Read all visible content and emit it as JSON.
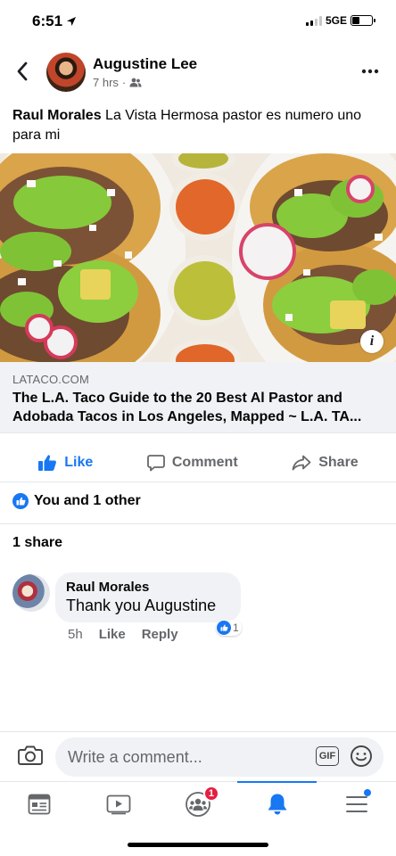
{
  "status_bar": {
    "time": "6:51",
    "network": "5GE",
    "battery_level": 0.4
  },
  "post": {
    "author": "Augustine Lee",
    "time_ago": "7 hrs",
    "audience_icon": "friends-icon",
    "text_author": "Raul Morales",
    "text_body": "La Vista Hermosa pastor es numero uno para mi"
  },
  "link": {
    "domain": "LATACO.COM",
    "title": "The L.A. Taco Guide to the 20 Best Al Pastor and Adobada Tacos in Los Angeles, Mapped ~ L.A. TA..."
  },
  "actions": {
    "like": "Like",
    "comment": "Comment",
    "share": "Share"
  },
  "reactions": {
    "summary": "You and 1 other"
  },
  "shares": {
    "label": "1 share"
  },
  "comment": {
    "author": "Raul Morales",
    "text": "Thank you Augustine",
    "time": "5h",
    "like_label": "Like",
    "reply_label": "Reply",
    "reaction_count": "1"
  },
  "composer": {
    "placeholder": "Write a comment...",
    "gif_label": "GIF"
  },
  "tabbar": {
    "active": "notifications",
    "groups_badge": "1"
  },
  "colors": {
    "accent": "#1877f2",
    "badge": "#e41e3f",
    "secondary_text": "#65676b"
  }
}
